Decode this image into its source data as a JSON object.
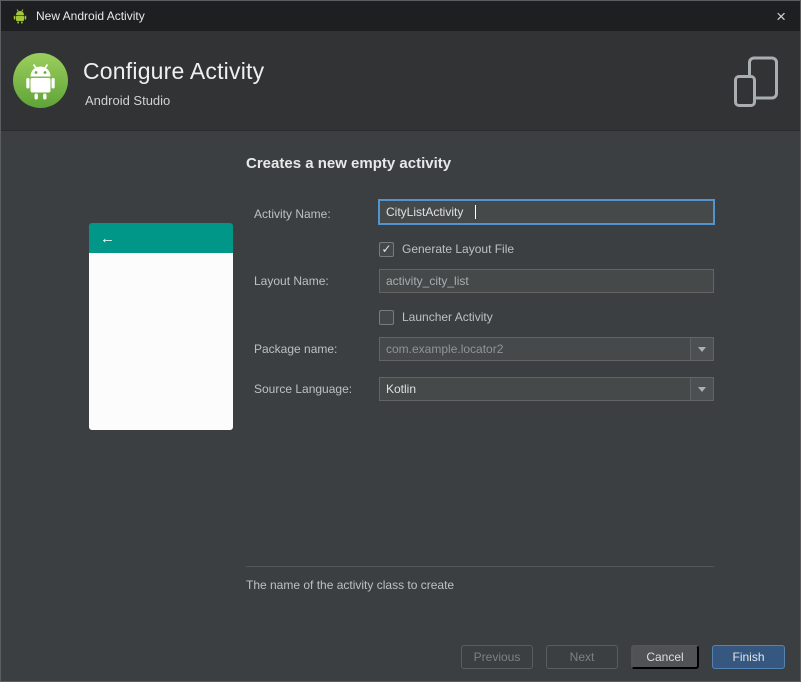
{
  "window": {
    "title": "New Android Activity",
    "close": "×"
  },
  "header": {
    "title": "Configure Activity",
    "subtitle": "Android Studio"
  },
  "form": {
    "heading": "Creates a new empty activity",
    "activity_name_label": "Activity Name:",
    "activity_name_value": "CityListActivity",
    "generate_layout_label": "Generate Layout File",
    "generate_layout_checked": true,
    "generate_layout_check": "✓",
    "layout_name_label": "Layout Name:",
    "layout_name_value": "activity_city_list",
    "launcher_label": "Launcher Activity",
    "launcher_checked": false,
    "launcher_check": "",
    "package_label": "Package name:",
    "package_value": "com.example.locator2",
    "source_label": "Source Language:",
    "source_value": "Kotlin",
    "help_text": "The name of the activity class to create"
  },
  "preview": {
    "back_arrow": "←"
  },
  "footer": {
    "previous": "Previous",
    "next": "Next",
    "cancel": "Cancel",
    "finish": "Finish"
  },
  "colors": {
    "accent_button": "#365880",
    "preview_appbar": "#009688",
    "focus_border": "#5394cf",
    "background": "#3c3f41",
    "header_background": "#313335",
    "titlebar_background": "#1d1f21"
  }
}
